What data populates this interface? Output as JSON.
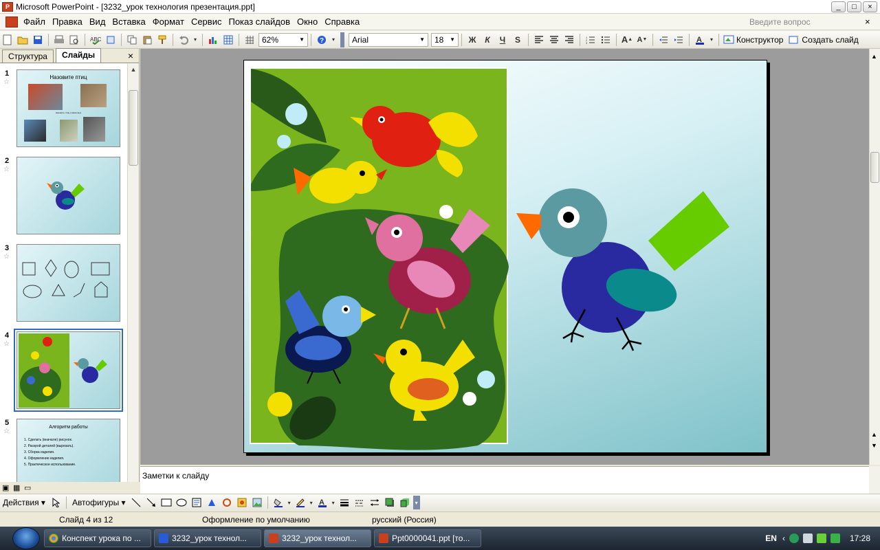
{
  "window": {
    "title": "Microsoft PowerPoint - [3232_урок технология презентация.ppt]",
    "app_icon": "P",
    "controls": [
      "_",
      "□",
      "×"
    ]
  },
  "menu": {
    "items": [
      "Файл",
      "Правка",
      "Вид",
      "Вставка",
      "Формат",
      "Сервис",
      "Показ слайдов",
      "Окно",
      "Справка"
    ],
    "question_placeholder": "Введите вопрос",
    "close_doc": "×"
  },
  "toolbar": {
    "zoom": "62%",
    "font_name": "Arial",
    "font_size": "18",
    "bold": "Ж",
    "italic": "К",
    "underline": "Ч",
    "shadow": "S",
    "designer_label": "Конструктор",
    "new_slide_label": "Создать слайд"
  },
  "panel": {
    "tab_outline": "Структура",
    "tab_slides": "Слайды",
    "close": "×",
    "slides": [
      {
        "num": "1",
        "title": "Назовите птиц",
        "caption": "Назовите птиц и животных"
      },
      {
        "num": "2"
      },
      {
        "num": "3"
      },
      {
        "num": "4"
      },
      {
        "num": "5",
        "title": "Алгоритм работы",
        "lines": [
          "Сделать (вначале) рисунок.",
          "Раскрой деталей (вырезать).",
          "Сборка изделия.",
          "Оформление изделия.",
          "Практическое использование."
        ]
      }
    ]
  },
  "notes": {
    "placeholder": "Заметки к слайду"
  },
  "drawbar": {
    "actions_label": "Действия",
    "autoshapes_label": "Автофигуры"
  },
  "status": {
    "slide_counter": "Слайд 4 из 12",
    "design": "Оформление по умолчанию",
    "language": "русский (Россия)"
  },
  "taskbar": {
    "tasks": [
      {
        "label": "Конспект урока по ...",
        "color": "#e8a020"
      },
      {
        "label": "3232_урок технол...",
        "color": "#2a5bd7"
      },
      {
        "label": "3232_урок технол...",
        "color": "#c8401e"
      },
      {
        "label": "Ppt0000041.ppt [то...",
        "color": "#c8401e"
      }
    ],
    "clock": "17:28",
    "lang": "EN"
  },
  "colors": {
    "accent": "#316ac5",
    "slide_bg_top": "#ffffff",
    "slide_bg_bottom": "#7fc2c9",
    "collage_green": "#7ab51d",
    "bird_body": "#2a2aa0",
    "bird_head": "#5b9aa0",
    "bird_tail": "#66cc00",
    "beak": "#ff6a00"
  }
}
